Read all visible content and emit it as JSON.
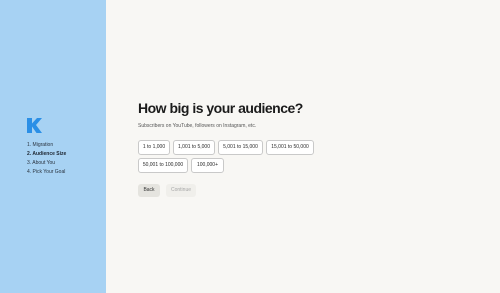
{
  "sidebar": {
    "logo_letter": "K",
    "steps": [
      "1. Migration",
      "2. Audience Size",
      "3. About You",
      "4. Pick Your Goal"
    ]
  },
  "main": {
    "title": "How big is your audience?",
    "subtitle": "Subscribers on YouTube, followers on Instagram, etc.",
    "options": [
      "1 to 1,000",
      "1,001 to 5,000",
      "5,001 to 15,000",
      "15,001 to 50,000",
      "50,001 to 100,000",
      "100,000+"
    ],
    "back_label": "Back",
    "continue_label": "Continue"
  },
  "colors": {
    "sidebar_bg": "#a7d2f3",
    "logo": "#2b8fe6",
    "page_bg": "#f8f7f4"
  }
}
